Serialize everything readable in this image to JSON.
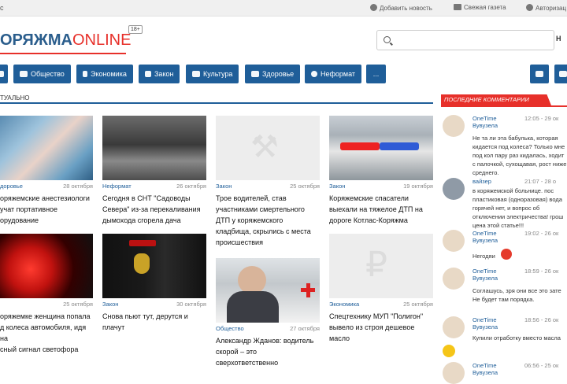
{
  "topbar": {
    "left": "c",
    "add_news": "Добавить новость",
    "fresh_paper": "Свежая газета",
    "auth": "Авторизац"
  },
  "logo": {
    "part1": "ОРЯЖМА",
    "part2": "ONLINE",
    "age": "18+"
  },
  "search": {
    "placeholder": "",
    "button": "Н"
  },
  "nav": {
    "items": [
      "Общество",
      "Экономика",
      "Закон",
      "Культура",
      "Здоровье",
      "Неформат",
      "..."
    ]
  },
  "section": {
    "title": "ТУАЛЬНО"
  },
  "sidebar": {
    "title": "ПОСЛЕДНИЕ КОММЕНТАРИИ"
  },
  "articles": [
    {
      "cat": "доровье",
      "date": "28 октября",
      "title": "оряжемские анестезиологи\nучат портативное\nорудование"
    },
    {
      "cat": "Неформат",
      "date": "26 октября",
      "title": "Сегодня в СНТ \"Садоводы\nСевера\" из-за перекаливания\nдымохода сгорела дача"
    },
    {
      "cat": "Закон",
      "date": "25 октября",
      "title": "Трое водителей, став\nучастниками смертельного\nДТП у коряжемского\nкладбища, скрылись с места\nпроисшествия"
    },
    {
      "cat": "Закон",
      "date": "19 октября",
      "title": "Коряжемские спасатели\nвыехали на тяжелое ДТП на\nдороге Котлас-Коряжма"
    },
    {
      "cat": "",
      "date": "25 октября",
      "title": "оряжемке женщина попала\nд колеса автомобиля, идя на\nсный сигнал светофора"
    },
    {
      "cat": "Закон",
      "date": "30 октября",
      "title": "Снова пьют тут, дерутся и\nплачут"
    },
    {
      "cat": "Общество",
      "date": "27 октября",
      "title": "Александр Жданов: водитель\nскорой – это\nсверхответственно"
    },
    {
      "cat": "Экономика",
      "date": "25 октября",
      "title": "Спецтехнику МУП \"Полигон\"\nвывело из строя дешевое\nмасло"
    }
  ],
  "comments": [
    {
      "user": "OneTime\nВувузела",
      "time": "12:05 - 29 ок",
      "text": "Не та ли эта бабулька, которая кидается под колеса? Только мне под кол пару раз кидалась, ходит с палочкой, сухощавая, рост ниже среднего."
    },
    {
      "user": "вайзер",
      "time": "21:07 - 28 о",
      "text": "в коряжемской больнице. пос пластиковая (одноразовая) вода горячей нет, и вопрос об отключении электричества! грош цена этой статье!!!"
    },
    {
      "user": "OneTime\nВувузела",
      "time": "19:02 - 26 ок",
      "text": "Негодяи"
    },
    {
      "user": "OneTime\nВувузела",
      "time": "18:59 - 26 ок",
      "text": "Соглашусь, зря они все это зате Не будет там порядка."
    },
    {
      "user": "OneTime\nВувузела",
      "time": "18:56 - 26 ок",
      "text": "Купили отработку вместо масла"
    },
    {
      "user": "OneTime\nВувузела",
      "time": "06:56 - 25 ок",
      "text": ""
    }
  ]
}
